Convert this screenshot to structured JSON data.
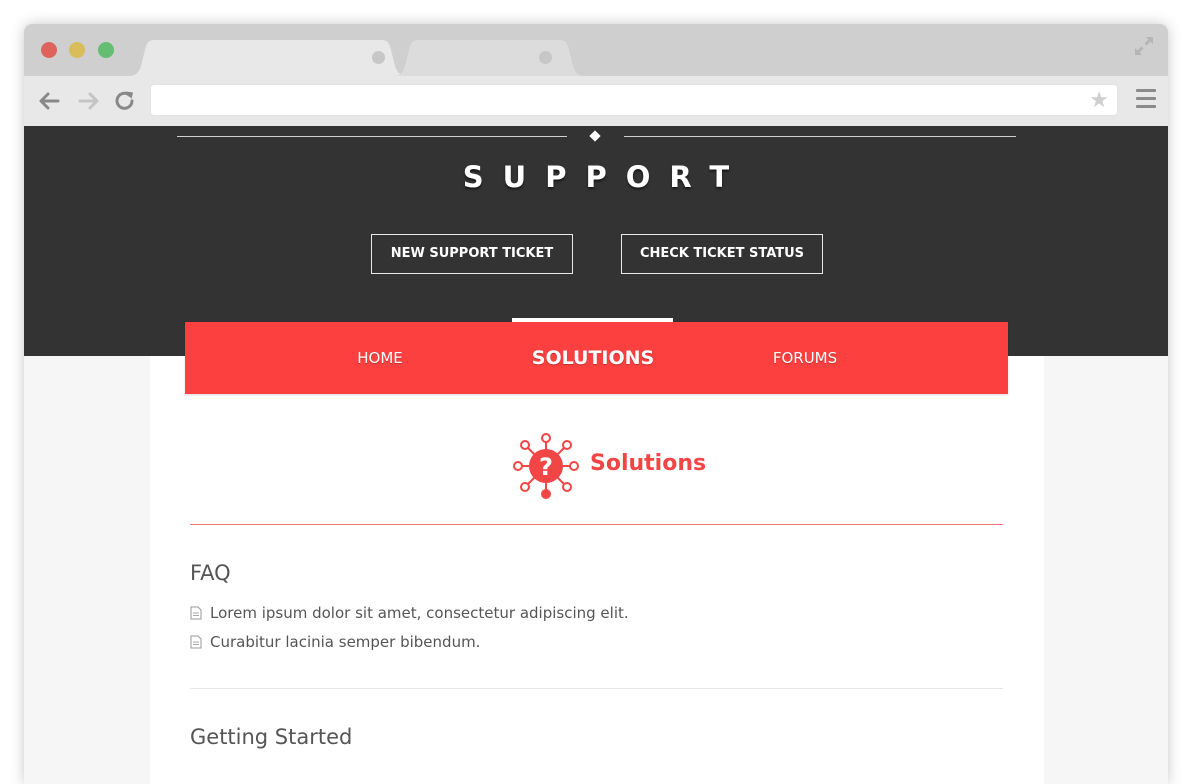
{
  "browser": {
    "address_value": ""
  },
  "hero": {
    "title": "SUPPORT",
    "buttons": [
      {
        "label": "NEW SUPPORT TICKET"
      },
      {
        "label": "CHECK TICKET STATUS"
      }
    ]
  },
  "nav": {
    "items": [
      {
        "label": "HOME"
      },
      {
        "label": "SOLUTIONS"
      },
      {
        "label": "FORUMS"
      }
    ],
    "active": "SOLUTIONS"
  },
  "solutions": {
    "title": "Solutions",
    "icon": "question-network-icon"
  },
  "sections": [
    {
      "title": "FAQ",
      "items": [
        "Lorem ipsum dolor sit amet, consectetur adipiscing elit.",
        "Curabitur lacinia semper bibendum."
      ]
    },
    {
      "title": "Getting Started",
      "items": []
    }
  ],
  "colors": {
    "accent": "#fc4040",
    "hero_bg": "#333333",
    "text": "#555555"
  }
}
